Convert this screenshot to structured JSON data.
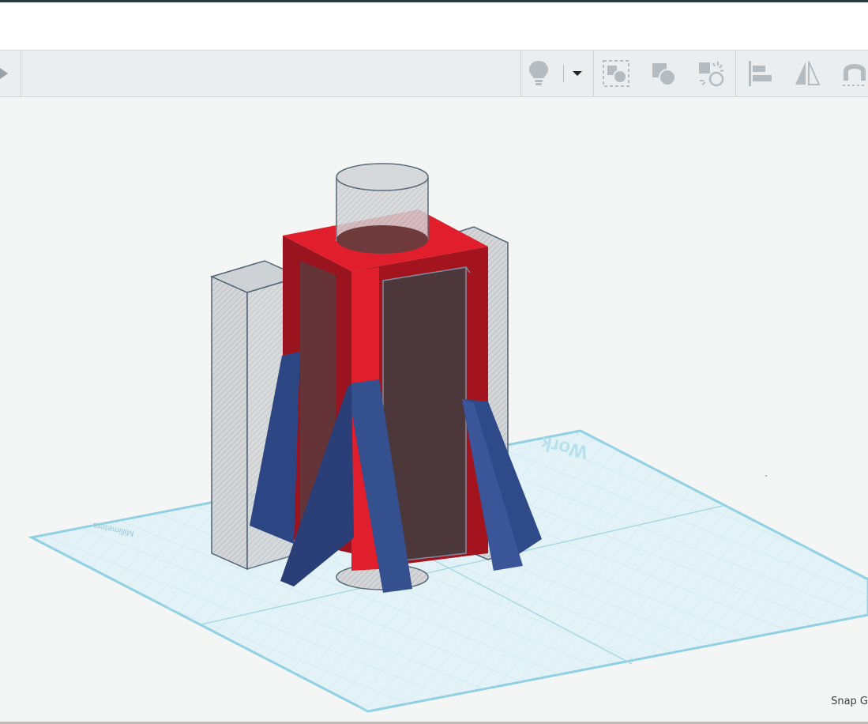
{
  "toolbar": {
    "icons": {
      "play": "play-arrow-icon",
      "light": "lightbulb-icon",
      "light_dropdown": "caret-down-icon",
      "group": "group-icon",
      "ungroup": "ungroup-icon",
      "hole": "hole-icon",
      "align": "align-icon",
      "mirror": "mirror-icon",
      "magnet": "magnet-icon"
    }
  },
  "workplane": {
    "label": "Work",
    "units_label": "Millimeters"
  },
  "status": {
    "snap_label": "Snap G"
  },
  "colors": {
    "red_shape": "#e01e2b",
    "blue_fins": "#2f4a8c",
    "workplane": "#dff1f5",
    "workplane_edge": "#8fd0e4"
  }
}
